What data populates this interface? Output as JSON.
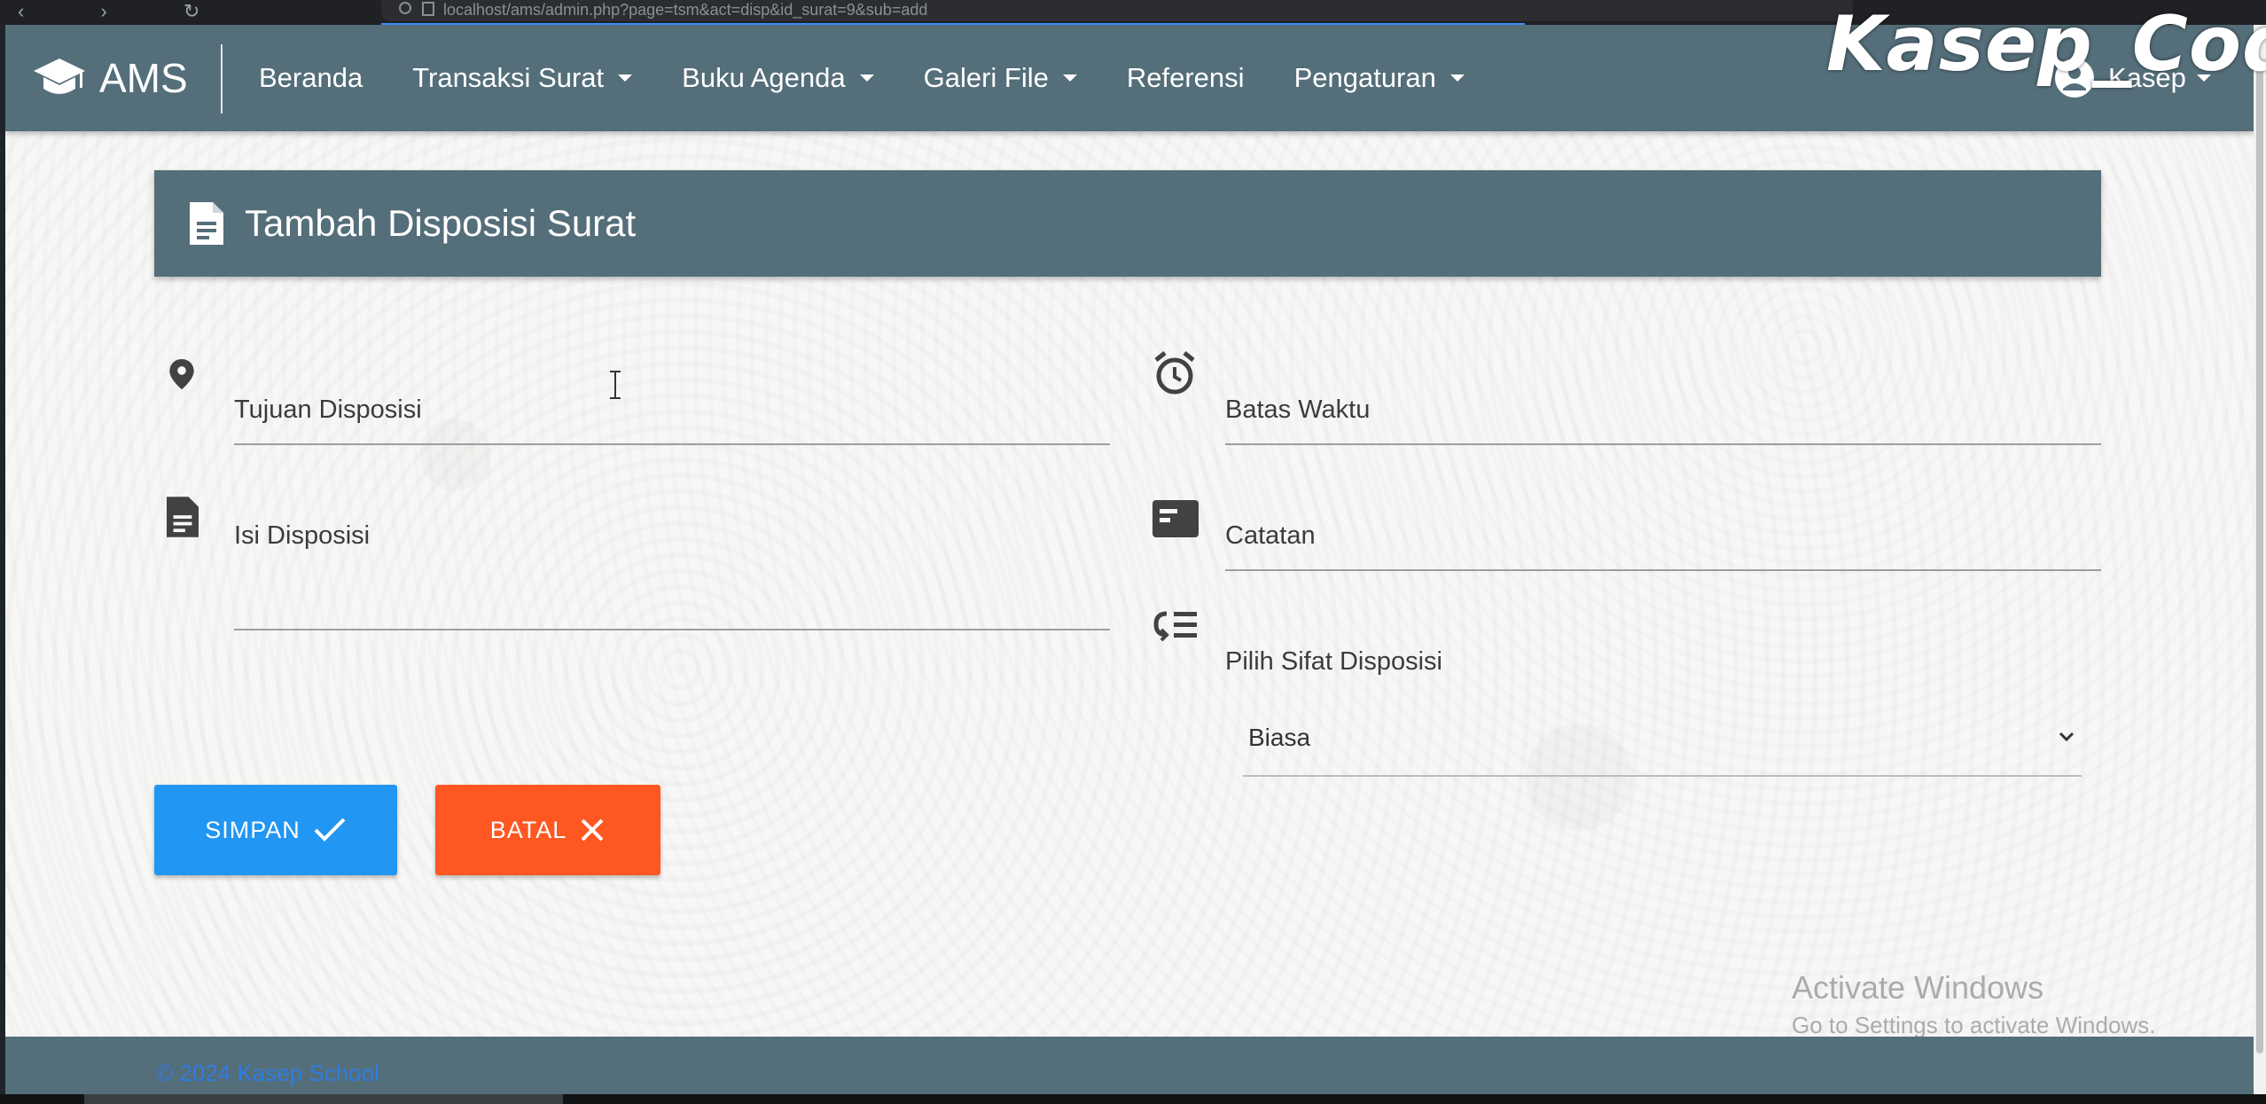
{
  "browser": {
    "url": "localhost/ams/admin.php?page=tsm&act=disp&id_surat=9&sub=add"
  },
  "navbar": {
    "brand": "AMS",
    "menu": [
      {
        "label": "Beranda",
        "dropdown": false
      },
      {
        "label": "Transaksi Surat",
        "dropdown": true
      },
      {
        "label": "Buku Agenda",
        "dropdown": true
      },
      {
        "label": "Galeri File",
        "dropdown": true
      },
      {
        "label": "Referensi",
        "dropdown": false
      },
      {
        "label": "Pengaturan",
        "dropdown": true
      }
    ],
    "user": "Kasep"
  },
  "card": {
    "title": "Tambah Disposisi Surat"
  },
  "form": {
    "tujuan": {
      "label": "Tujuan Disposisi",
      "icon": "location-pin-icon"
    },
    "isi": {
      "label": "Isi Disposisi",
      "icon": "document-icon"
    },
    "batas": {
      "label": "Batas Waktu",
      "icon": "alarm-clock-icon"
    },
    "catatan": {
      "label": "Catatan",
      "icon": "card-icon"
    },
    "sifat": {
      "label": "Pilih Sifat Disposisi",
      "icon": "list-icon",
      "selected": "Biasa"
    }
  },
  "buttons": {
    "save": "SIMPAN",
    "cancel": "BATAL"
  },
  "footer": {
    "copyright": "© 2024 Kasep School"
  },
  "watermark": {
    "line1": "Activate Windows",
    "line2": "Go to Settings to activate Windows."
  },
  "overlay": {
    "text": "Kasep_Code"
  },
  "colors": {
    "navbar": "#546e7a",
    "save": "#2196f3",
    "cancel": "#ff5722"
  }
}
